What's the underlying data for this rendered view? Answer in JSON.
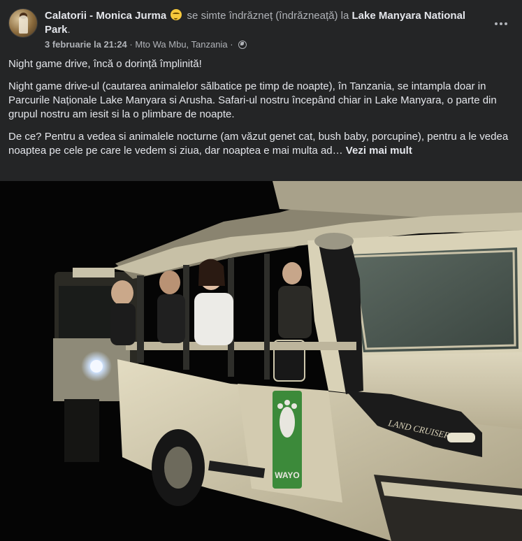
{
  "header": {
    "author": "Calatorii - Monica Jurma",
    "feeling_text": " se simte îndrăzneț (îndrăzneață) la ",
    "place": "Lake Manyara National Park",
    "after_place": ".",
    "date": "3 februarie la 21:24",
    "separator": " · ",
    "location": "Mto Wa Mbu, Tanzania",
    "separator2": " · "
  },
  "post": {
    "paragraphs": [
      "Night game drive, încă o dorință împlinită!",
      "Night game drive-ul (cautarea animalelor sălbatice pe timp de noapte), în Tanzania, se intampla doar in Parcurile Naționale Lake Manyara si Arusha. Safari-ul nostru începând chiar in Lake Manyara, o parte din grupul nostru am iesit si la o plimbare de noapte.",
      "De ce? Pentru a vedea si animalele nocturne (am văzut genet cat, bush baby, porcupine), pentru a le vedea noaptea pe cele pe care le vedem si ziua, dar noaptea e mai multa ad…"
    ],
    "see_more": "Vezi mai mult"
  },
  "photo": {
    "vehicle_brand": "LAND CRUISER",
    "door_logo": "WAYO"
  },
  "icons": {
    "emoji": "feeling-icon",
    "privacy": "globe-icon",
    "menu": "more-options-icon"
  },
  "colors": {
    "background": "#242526",
    "text_primary": "#e4e6eb",
    "text_secondary": "#b0b3b8",
    "vehicle_body": "#cfc6a8",
    "logo_green": "#3c8a3a"
  }
}
